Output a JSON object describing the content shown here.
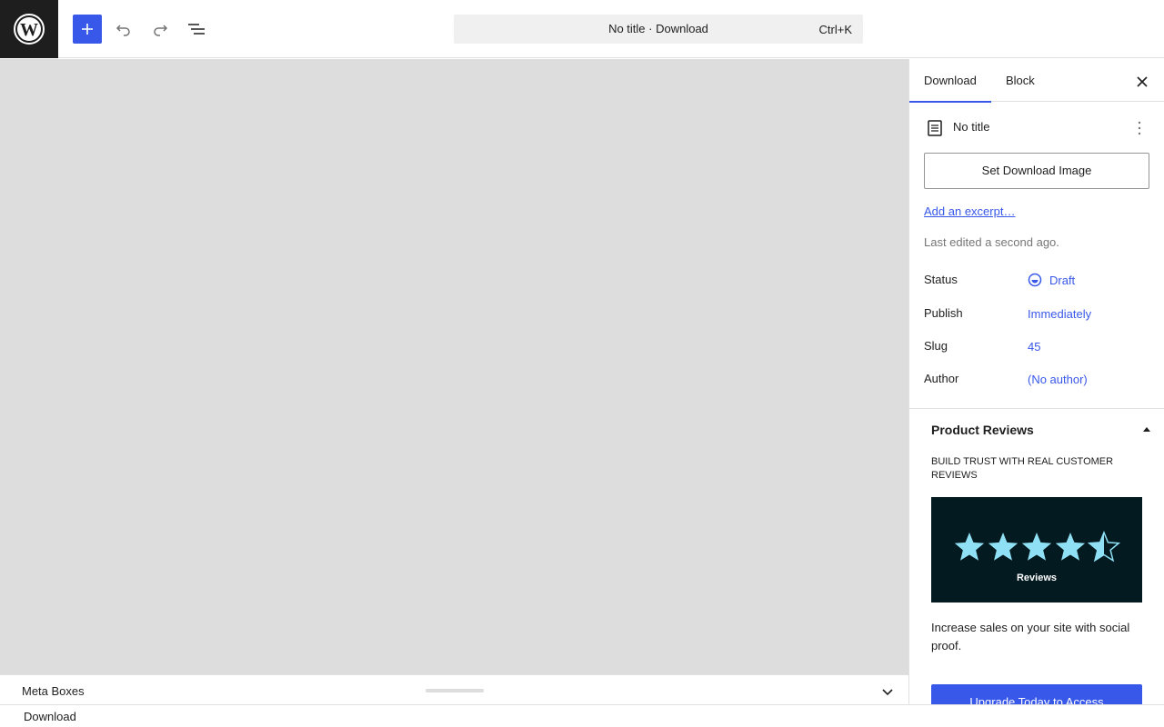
{
  "header": {
    "logo_icon": "wordpress-logo-icon",
    "add_block_icon": "plus-icon",
    "undo_icon": "undo-icon",
    "redo_icon": "redo-icon",
    "document_overview_icon": "list-view-icon",
    "command_bar": {
      "title": "No title · Download",
      "shortcut": "Ctrl+K"
    },
    "accent_color": "#3858e9"
  },
  "canvas": {
    "background": "#dddddd"
  },
  "meta_boxes": {
    "label": "Meta Boxes",
    "toggle_icon": "chevron-down-icon"
  },
  "footer": {
    "breadcrumb": "Download"
  },
  "sidebar": {
    "tabs": [
      {
        "label": "Download",
        "active": true
      },
      {
        "label": "Block",
        "active": false
      }
    ],
    "close_icon": "close-icon",
    "document": {
      "icon": "page-icon",
      "title": "No title",
      "actions_icon": "more-vertical-icon"
    },
    "set_image_label": "Set Download Image",
    "excerpt_link": "Add an excerpt…",
    "last_edited": "Last edited a second ago.",
    "properties": [
      {
        "label": "Status",
        "value": "Draft",
        "icon": "draft-status-icon"
      },
      {
        "label": "Publish",
        "value": "Immediately"
      },
      {
        "label": "Slug",
        "value": "45"
      },
      {
        "label": "Author",
        "value": "(No author)"
      }
    ],
    "product_reviews": {
      "title": "Product Reviews",
      "toggle_icon": "chevron-up-icon",
      "heading": "BUILD TRUST WITH REAL CUSTOMER REVIEWS",
      "image": {
        "stars_icon": "star-rating-icon",
        "rating": 4.5,
        "max_rating": 5,
        "caption": "Reviews",
        "background": "#031a21",
        "star_color": "#8fe0f5"
      },
      "description": "Increase sales on your site with social proof.",
      "button_label": "Upgrade Today to Access"
    }
  }
}
